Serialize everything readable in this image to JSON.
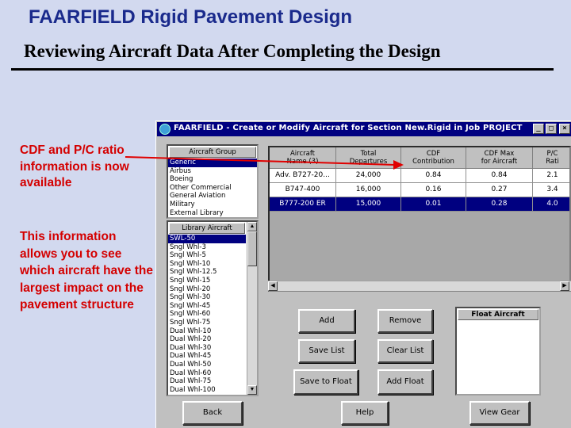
{
  "slide": {
    "title": "FAARFIELD Rigid Pavement Design",
    "subtitle": "Reviewing Aircraft Data After Completing the Design"
  },
  "callouts": [
    "CDF and P/C ratio information is now available",
    "This information allows you to see which aircraft have the largest impact on the pavement structure"
  ],
  "window": {
    "title": "FAARFIELD - Create or Modify Aircraft for Section New.Rigid in Job PROJECT",
    "controls": {
      "minimize": "_",
      "maximize": "□",
      "close": "×"
    }
  },
  "aircraft_group": {
    "header": "Aircraft Group",
    "items": [
      "Generic",
      "Airbus",
      "Boeing",
      "Other Commercial",
      "General Aviation",
      "Military",
      "External Library"
    ],
    "selected_index": 0
  },
  "library_aircraft": {
    "header": "Library Aircraft",
    "items": [
      "SWL-50",
      "Sngl Whl-3",
      "Sngl Whl-5",
      "Sngl Whl-10",
      "Sngl Whl-12.5",
      "Sngl Whl-15",
      "Sngl Whl-20",
      "Sngl Whl-30",
      "Sngl Whl-45",
      "Sngl Whl-60",
      "Sngl Whl-75",
      "Dual Whl-10",
      "Dual Whl-20",
      "Dual Whl-30",
      "Dual Whl-45",
      "Dual Whl-50",
      "Dual Whl-60",
      "Dual Whl-75",
      "Dual Whl-100"
    ],
    "selected_index": 0
  },
  "aircraft_table": {
    "columns": [
      [
        "Aircraft",
        "Name (3)"
      ],
      [
        "Total",
        "Departures"
      ],
      [
        "CDF",
        "Contribution"
      ],
      [
        "CDF Max",
        "for Aircraft"
      ],
      [
        "P/C",
        "Rati"
      ]
    ],
    "rows": [
      [
        "Adv. B727-20...",
        "24,000",
        "0.84",
        "0.84",
        "2.1"
      ],
      [
        "B747-400",
        "16,000",
        "0.16",
        "0.27",
        "3.4"
      ],
      [
        "B777-200 ER",
        "15,000",
        "0.01",
        "0.28",
        "4.0"
      ]
    ],
    "selected_row": 2
  },
  "buttons": {
    "add": "Add",
    "remove": "Remove",
    "save_list": "Save List",
    "clear_list": "Clear List",
    "save_to_float": "Save to Float",
    "add_float": "Add Float",
    "back": "Back",
    "help": "Help",
    "view_gear": "View Gear"
  },
  "float_aircraft": {
    "header": "Float Aircraft"
  },
  "colors": {
    "slide_background": "#d2d9ef",
    "title_blue": "#1a2a8c",
    "callout_red": "#d40000",
    "window_gray": "#c0c0c0",
    "selection_navy": "#000080",
    "arrow_red": "#e00000"
  },
  "icons": {
    "window": "app-icon",
    "scroll_up": "triangle-up-icon",
    "scroll_down": "triangle-down-icon",
    "scroll_left": "triangle-left-icon",
    "scroll_right": "triangle-right-icon"
  }
}
